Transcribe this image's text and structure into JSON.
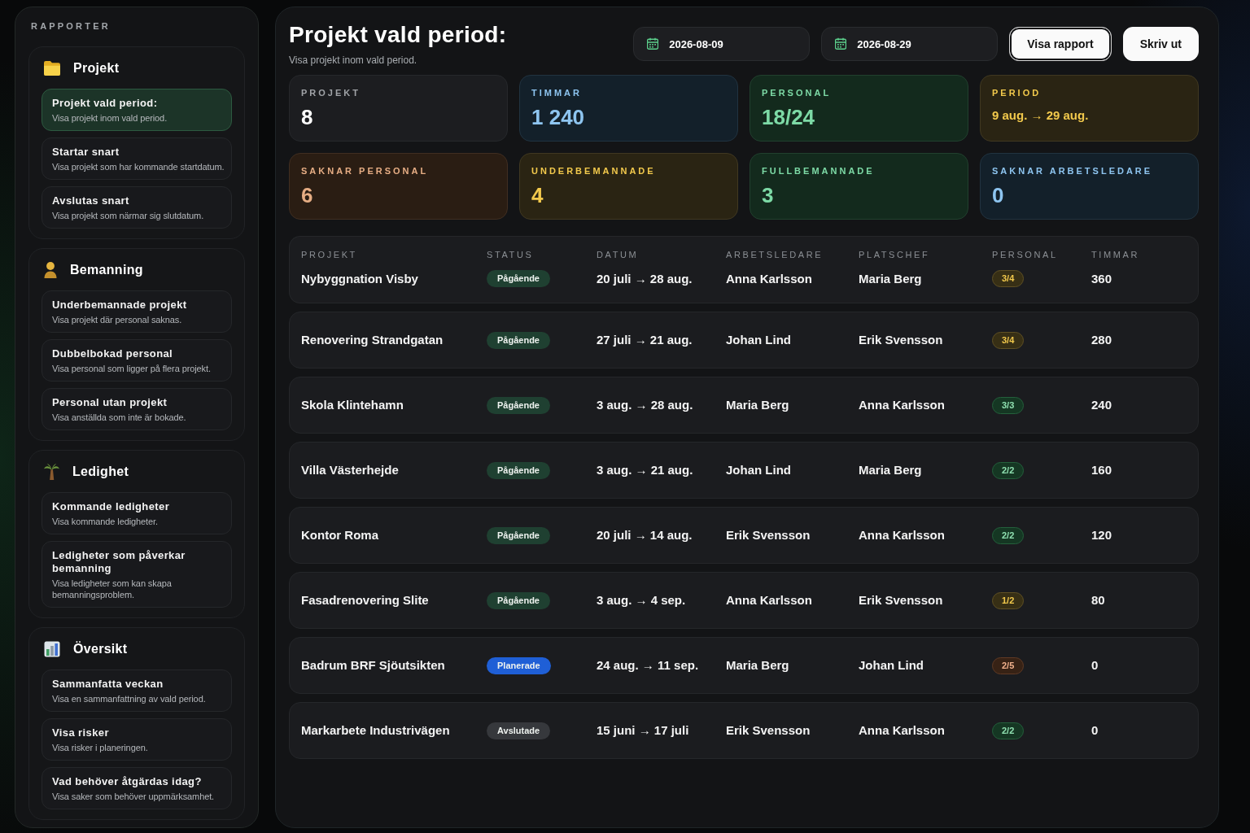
{
  "sidebar": {
    "heading": "RAPPORTER",
    "sections": [
      {
        "title": "Projekt",
        "items": [
          {
            "title": "Projekt vald period:",
            "description": "Visa projekt inom vald period.",
            "selected": true
          },
          {
            "title": "Startar snart",
            "description": "Visa projekt som har kommande startdatum.",
            "selected": false
          },
          {
            "title": "Avslutas snart",
            "description": "Visa projekt som närmar sig slutdatum.",
            "selected": false
          }
        ]
      },
      {
        "title": "Bemanning",
        "items": [
          {
            "title": "Underbemannade projekt",
            "description": "Visa projekt där personal saknas.",
            "selected": false
          },
          {
            "title": "Dubbelbokad personal",
            "description": "Visa personal som ligger på flera projekt.",
            "selected": false
          },
          {
            "title": "Personal utan projekt",
            "description": "Visa anställda som inte är bokade.",
            "selected": false
          }
        ]
      },
      {
        "title": "Ledighet",
        "items": [
          {
            "title": "Kommande ledigheter",
            "description": "Visa kommande ledigheter.",
            "selected": false
          },
          {
            "title": "Ledigheter som påverkar bemanning",
            "description": "Visa ledigheter som kan skapa bemanningsproblem.",
            "selected": false
          }
        ]
      },
      {
        "title": "Översikt",
        "items": [
          {
            "title": "Sammanfatta veckan",
            "description": "Visa en sammanfattning av vald period.",
            "selected": false
          },
          {
            "title": "Visa risker",
            "description": "Visa risker i planeringen.",
            "selected": false
          },
          {
            "title": "Vad behöver åtgärdas idag?",
            "description": "Visa saker som behöver uppmärksamhet.",
            "selected": false
          }
        ]
      }
    ]
  },
  "header": {
    "title": "Projekt vald period:",
    "subtitle": "Visa projekt inom vald period.",
    "date_fields": [
      {
        "value": "2026-08-09"
      },
      {
        "value": "2026-08-29"
      }
    ],
    "buttons": [
      {
        "label": "Visa rapport",
        "focused": true
      },
      {
        "label": "Skriv ut",
        "focused": false
      }
    ]
  },
  "stats": [
    {
      "label": "PROJEKT",
      "value": "8",
      "kind": "count"
    },
    {
      "label": "TIMMAR",
      "value": "1 240",
      "kind": "count",
      "color": "#8ec5f0"
    },
    {
      "label": "PERSONAL",
      "value": "18/24",
      "kind": "count",
      "color": "#7ddaa6"
    },
    {
      "label": "PERIOD",
      "value": "9 aug. → 29 aug.",
      "kind": "range",
      "color": "#f2c94c"
    },
    {
      "label": "SAKNAR PERSONAL",
      "value": "6",
      "kind": "count",
      "color": "#e6ad84"
    },
    {
      "label": "UNDERBEMANNADE",
      "value": "4",
      "kind": "count",
      "color": "#f2c94c"
    },
    {
      "label": "FULLBEMANNADE",
      "value": "3",
      "kind": "count",
      "color": "#7ddaa6"
    },
    {
      "label": "SAKNAR ARBETSLEDARE",
      "value": "0",
      "kind": "count",
      "color": "#8ec5f0"
    }
  ],
  "table": {
    "columns": [
      "PROJEKT",
      "STATUS",
      "DATUM",
      "ARBETSLEDARE",
      "PLATSCHEF",
      "PERSONAL",
      "TIMMAR"
    ],
    "rows": [
      {
        "project": "Nybyggnation Visby",
        "status": {
          "label": "Pågående",
          "color": "#1f4031"
        },
        "dates": "20 juli → 28 aug.",
        "foreman": "Anna Karlsson",
        "site_manager": "Maria Berg",
        "staffing": {
          "label": "3/4",
          "color": "#f2c94c"
        },
        "hours": "360"
      },
      {
        "project": "Renovering Strandgatan",
        "status": {
          "label": "Pågående",
          "color": "#1f4031"
        },
        "dates": "27 juli → 21 aug.",
        "foreman": "Johan Lind",
        "site_manager": "Erik Svensson",
        "staffing": {
          "label": "3/4",
          "color": "#f2c94c"
        },
        "hours": "280"
      },
      {
        "project": "Skola Klintehamn",
        "status": {
          "label": "Pågående",
          "color": "#1f4031"
        },
        "dates": "3 aug. → 28 aug.",
        "foreman": "Maria Berg",
        "site_manager": "Anna Karlsson",
        "staffing": {
          "label": "3/3",
          "color": "#8fe0b0"
        },
        "hours": "240"
      },
      {
        "project": "Villa Västerhejde",
        "status": {
          "label": "Pågående",
          "color": "#1f4031"
        },
        "dates": "3 aug. → 21 aug.",
        "foreman": "Johan Lind",
        "site_manager": "Maria Berg",
        "staffing": {
          "label": "2/2",
          "color": "#8fe0b0"
        },
        "hours": "160"
      },
      {
        "project": "Kontor Roma",
        "status": {
          "label": "Pågående",
          "color": "#1f4031"
        },
        "dates": "20 juli → 14 aug.",
        "foreman": "Erik Svensson",
        "site_manager": "Anna Karlsson",
        "staffing": {
          "label": "2/2",
          "color": "#8fe0b0"
        },
        "hours": "120"
      },
      {
        "project": "Fasadrenovering Slite",
        "status": {
          "label": "Pågående",
          "color": "#1f4031"
        },
        "dates": "3 aug. → 4 sep.",
        "foreman": "Anna Karlsson",
        "site_manager": "Erik Svensson",
        "staffing": {
          "label": "1/2",
          "color": "#f2c94c"
        },
        "hours": "80"
      },
      {
        "project": "Badrum BRF Sjöutsikten",
        "status": {
          "label": "Planerade",
          "color": "#1f5fd6"
        },
        "dates": "24 aug. → 11 sep.",
        "foreman": "Maria Berg",
        "site_manager": "Johan Lind",
        "staffing": {
          "label": "2/5",
          "color": "#f0b08c"
        },
        "hours": "0"
      },
      {
        "project": "Markarbete Industrivägen",
        "status": {
          "label": "Avslutade",
          "color": "#36383c"
        },
        "dates": "15 juni → 17 juli",
        "foreman": "Erik Svensson",
        "site_manager": "Anna Karlsson",
        "staffing": {
          "label": "2/2",
          "color": "#8fe0b0"
        },
        "hours": "0"
      }
    ]
  }
}
